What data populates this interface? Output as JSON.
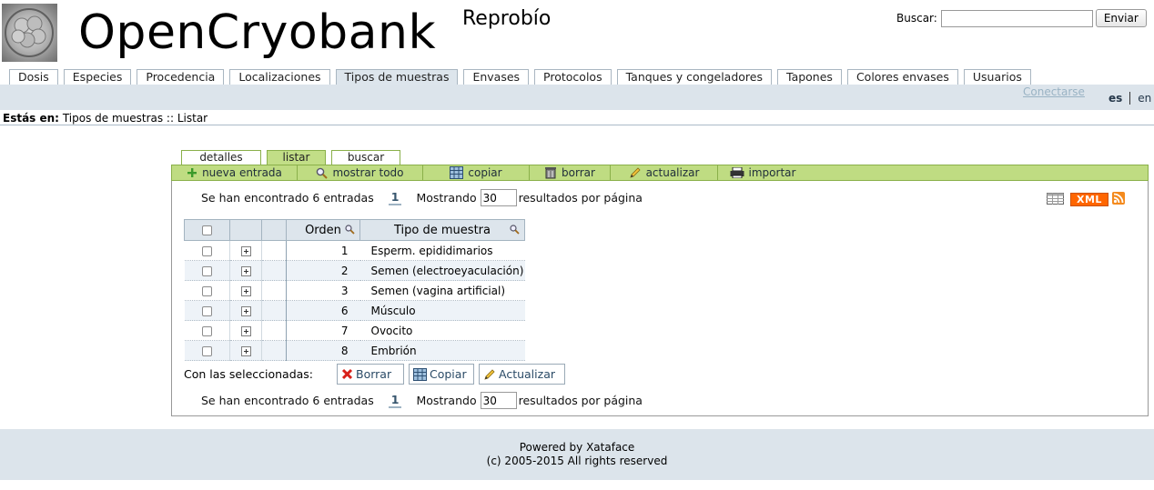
{
  "header": {
    "title": "OpenCryobank",
    "subtitle": "Reprobío",
    "search_label": "Buscar:",
    "search_value": "",
    "search_button": "Enviar"
  },
  "nav": {
    "tabs": [
      {
        "label": "Dosis",
        "active": false
      },
      {
        "label": "Especies",
        "active": false
      },
      {
        "label": "Procedencia",
        "active": false
      },
      {
        "label": "Localizaciones",
        "active": false
      },
      {
        "label": "Tipos de muestras",
        "active": true
      },
      {
        "label": "Envases",
        "active": false
      },
      {
        "label": "Protocolos",
        "active": false
      },
      {
        "label": "Tanques y congeladores",
        "active": false
      },
      {
        "label": "Tapones",
        "active": false
      },
      {
        "label": "Colores envases",
        "active": false
      },
      {
        "label": "Usuarios",
        "active": false
      }
    ]
  },
  "userbar": {
    "connect": "Conectarse",
    "lang_es": "es",
    "lang_en": "en"
  },
  "breadcrumb": {
    "prefix": "Estás en:",
    "path": "Tipos de muestras :: Listar"
  },
  "subtabs": [
    "detalles",
    "listar",
    "buscar"
  ],
  "actions": {
    "new": "nueva entrada",
    "show_all": "mostrar todo",
    "copy": "copiar",
    "delete": "borrar",
    "update": "actualizar",
    "import": "importar"
  },
  "results": {
    "found": "Se han encontrado 6 entradas",
    "page": "1",
    "showing": "Mostrando",
    "per_page": "30",
    "per_page_suffix": "resultados por página"
  },
  "exports": {
    "xml": "XML"
  },
  "table": {
    "headers": {
      "order": "Orden",
      "type": "Tipo de muestra"
    },
    "rows": [
      {
        "order": "1",
        "type": "Esperm. epididimarios"
      },
      {
        "order": "2",
        "type": "Semen (electroeyaculación)"
      },
      {
        "order": "3",
        "type": "Semen (vagina artificial)"
      },
      {
        "order": "6",
        "type": "Músculo"
      },
      {
        "order": "7",
        "type": "Ovocito"
      },
      {
        "order": "8",
        "type": "Embrión"
      }
    ]
  },
  "selected": {
    "label": "Con las seleccionadas:",
    "delete": "Borrar",
    "copy": "Copiar",
    "update": "Actualizar"
  },
  "footer": {
    "line1": "Powered by Xataface",
    "line2": "(c) 2005-2015 All rights reserved"
  }
}
